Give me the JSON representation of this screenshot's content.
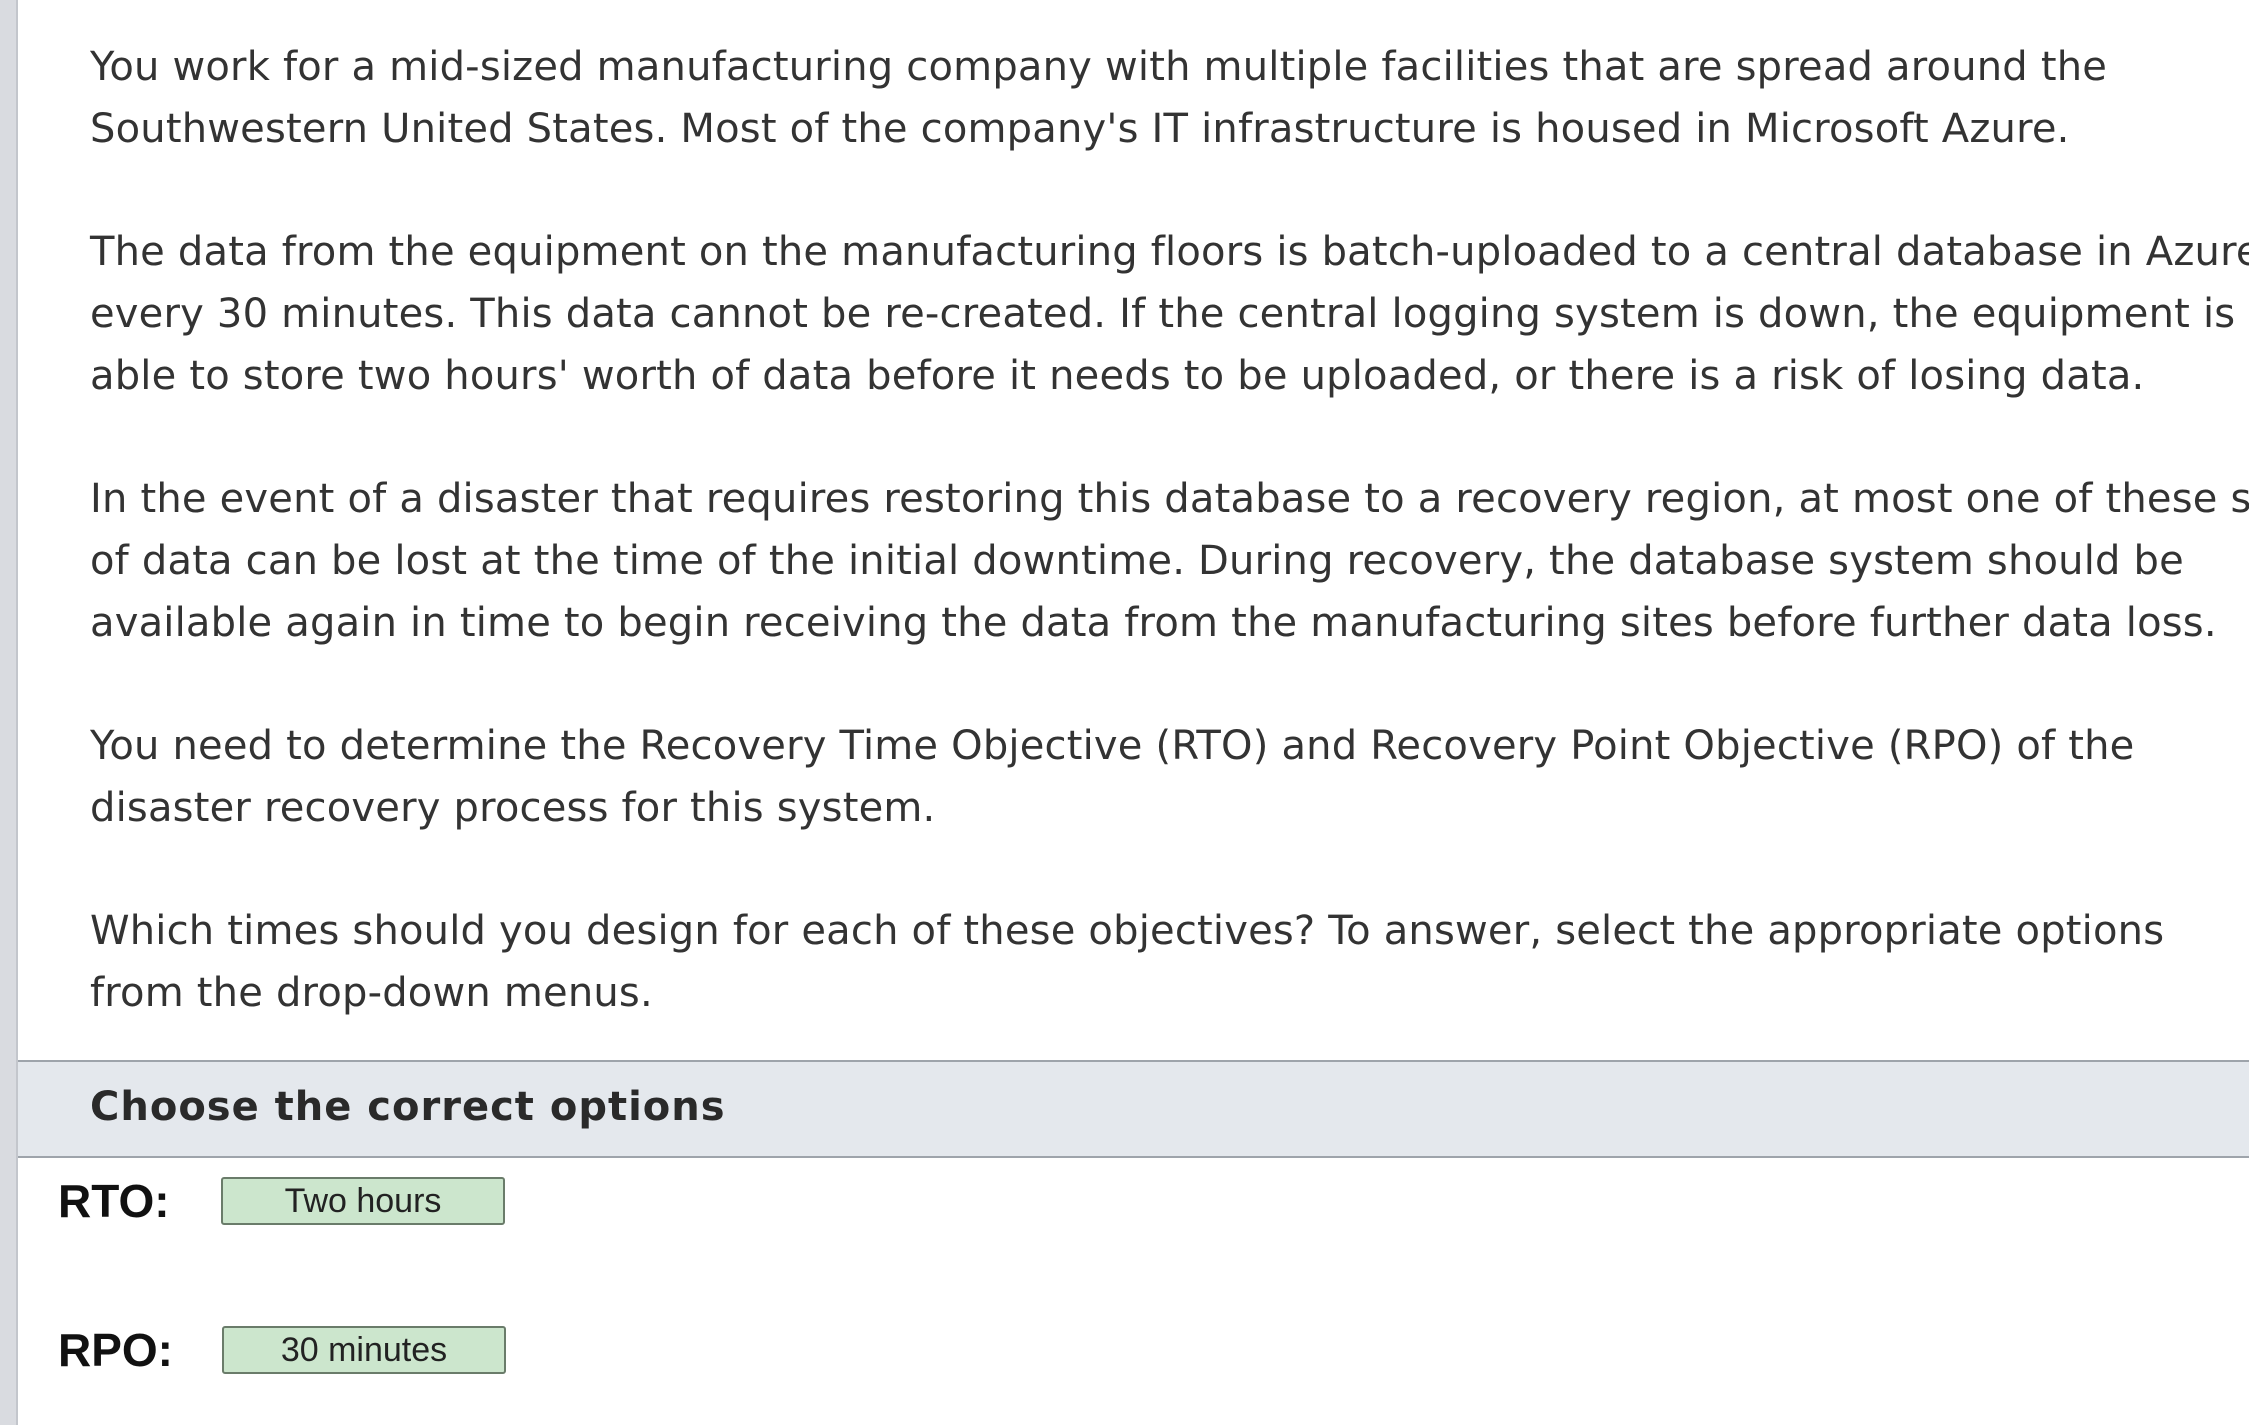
{
  "question": {
    "paragraphs": [
      [
        "You work for a mid-sized manufacturing company with multiple facilities that are spread around the",
        "Southwestern United States. Most of the company's IT infrastructure is housed in Microsoft Azure."
      ],
      [
        "The data from the equipment on the manufacturing floors is batch-uploaded to a central database in Azure",
        "every 30 minutes. This data cannot be re-created. If the central logging system is down, the equipment is",
        "able to store two hours' worth of data before it needs to be uploaded, or there is a risk of losing data."
      ],
      [
        "In the event of a disaster that requires restoring this database to a recovery region, at most one of these sets",
        "of data can be lost at the time of the initial downtime. During recovery, the database system should be",
        "available again in time to begin receiving the data from the manufacturing sites before further data loss."
      ],
      [
        "You need to determine the Recovery Time Objective (RTO) and Recovery Point Objective (RPO) of the",
        "disaster recovery process for this system."
      ],
      [
        "Which times should you design for each of these objectives? To answer, select the appropriate options",
        "from the drop-down menus."
      ]
    ]
  },
  "options_header": {
    "label": "Choose the correct options"
  },
  "answers": {
    "rto": {
      "label": "RTO:",
      "selected": "Two hours"
    },
    "rpo": {
      "label": "RPO:",
      "selected": "30 minutes"
    }
  },
  "colors": {
    "select_bg": "#cce6cd",
    "header_bg": "#e4e8ed",
    "text": "#333333"
  }
}
